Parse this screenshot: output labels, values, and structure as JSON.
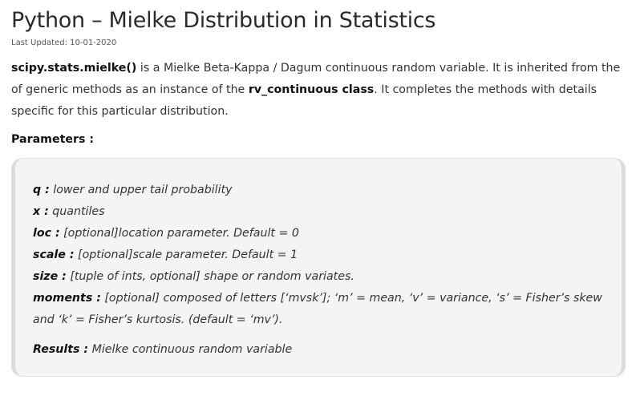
{
  "title": "Python – Mielke Distribution in Statistics",
  "last_updated": "Last Updated: 10-01-2020",
  "intro": {
    "term": "scipy.stats.mielke()",
    "text1": " is a Mielke Beta-Kappa / Dagum continuous random variable. It is inherited from the of generic methods as an instance of the ",
    "class_term": "rv_continuous class",
    "text2": ". It completes the methods with details specific for this particular distribution."
  },
  "parameters_heading": "Parameters :",
  "parameters": [
    {
      "name": "q :",
      "desc": " lower and upper tail probability"
    },
    {
      "name": "x :",
      "desc": " quantiles"
    },
    {
      "name": "loc :",
      "desc": " [optional]location parameter. Default = 0"
    },
    {
      "name": "scale :",
      "desc": " [optional]scale parameter. Default = 1"
    },
    {
      "name": "size :",
      "desc": " [tuple of ints, optional] shape or random variates."
    },
    {
      "name": "moments :",
      "desc": " [optional] composed of letters [‘mvsk’]; ‘m’ = mean, ‘v’ = variance, ‘s’ = Fisher’s skew and ‘k’ = Fisher’s kurtosis. (default = ‘mv’)."
    }
  ],
  "results": {
    "name": "Results :",
    "desc": " Mielke continuous random variable"
  }
}
